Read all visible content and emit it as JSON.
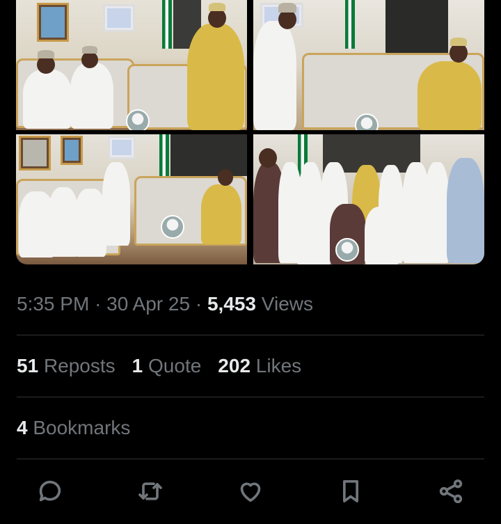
{
  "post": {
    "time": "5:35 PM",
    "separator": "·",
    "date": "30 Apr 25",
    "views_count": "5,453",
    "views_label": "Views"
  },
  "stats": [
    {
      "count": "51",
      "label": "Reposts"
    },
    {
      "count": "1",
      "label": "Quote"
    },
    {
      "count": "202",
      "label": "Likes"
    }
  ],
  "bookmarks": {
    "count": "4",
    "label": "Bookmarks"
  },
  "actions": [
    "reply-icon",
    "repost-icon",
    "like-icon",
    "bookmark-icon",
    "share-icon"
  ],
  "colors": {
    "background": "#000000",
    "text_primary": "#e7e9ea",
    "text_secondary": "#71767b",
    "divider": "#2f3336"
  }
}
